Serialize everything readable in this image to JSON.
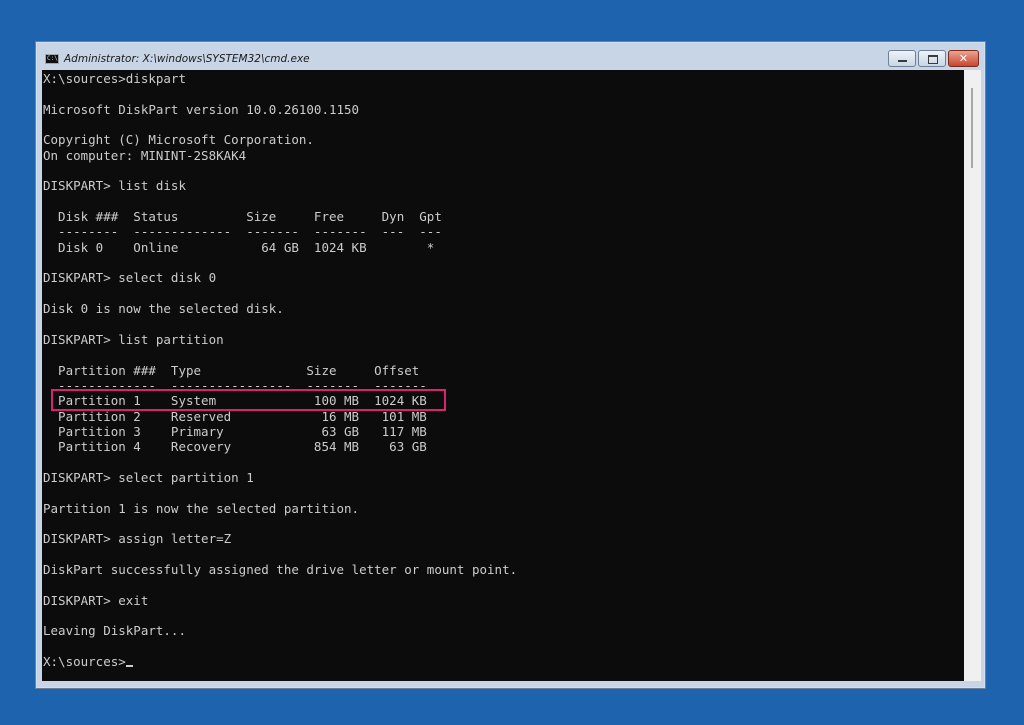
{
  "window": {
    "title": "Administrator: X:\\windows\\SYSTEM32\\cmd.exe",
    "icon_text": "C:\\"
  },
  "controls": {
    "minimize": "minimize",
    "maximize": "maximize",
    "close": "✕"
  },
  "console": {
    "lines": [
      "X:\\sources>diskpart",
      "",
      "Microsoft DiskPart version 10.0.26100.1150",
      "",
      "Copyright (C) Microsoft Corporation.",
      "On computer: MININT-2S8KAK4",
      "",
      "DISKPART> list disk",
      "",
      "  Disk ###  Status         Size     Free     Dyn  Gpt",
      "  --------  -------------  -------  -------  ---  ---",
      "  Disk 0    Online           64 GB  1024 KB        *",
      "",
      "DISKPART> select disk 0",
      "",
      "Disk 0 is now the selected disk.",
      "",
      "DISKPART> list partition",
      "",
      "  Partition ###  Type              Size     Offset",
      "  -------------  ----------------  -------  -------",
      "  Partition 1    System             100 MB  1024 KB",
      "  Partition 2    Reserved            16 MB   101 MB",
      "  Partition 3    Primary             63 GB   117 MB",
      "  Partition 4    Recovery           854 MB    63 GB",
      "",
      "DISKPART> select partition 1",
      "",
      "Partition 1 is now the selected partition.",
      "",
      "DISKPART> assign letter=Z",
      "",
      "DiskPart successfully assigned the drive letter or mount point.",
      "",
      "DISKPART> exit",
      "",
      "Leaving DiskPart...",
      "",
      "X:\\sources>"
    ]
  },
  "colors": {
    "desktop": "#1e63ad",
    "console_bg": "#0c0c0c",
    "console_text": "#cccccc",
    "highlight": "#d6246e"
  }
}
